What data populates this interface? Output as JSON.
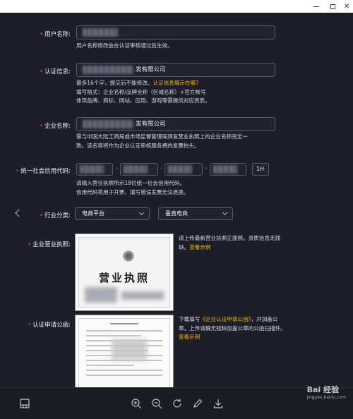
{
  "form": {
    "username": {
      "label": "用户名称:",
      "hint": "用户名称修改会在认证审核通过后生效。"
    },
    "cert_info": {
      "label": "认证信息:",
      "value_suffix": "发有限公司",
      "hint_prefix": "最多16个字，提交后不能修改。",
      "hint_link": "认证信息展示在哪？",
      "hint_line2": "填写格式：企业名称/品牌全称（区域名称）+官方帐号",
      "hint_line3": "体现品牌、商标、网站、应用、游戏等需提供对应资质。"
    },
    "company_name": {
      "label": "企业名称:",
      "value_suffix": "发有限公司",
      "hint_line1": "需与中国大陆工商局或市场监督管理局颁发营业执照上的企业名称完全一",
      "hint_line2": "致。该名称将作为企业认证审核服务费的发票抬头。"
    },
    "credit_code": {
      "label": "统一社会信用代码:",
      "separator": "-",
      "last_segment": "1H",
      "hint_line1": "请输入营业执照所示18位统一社会信用代码。",
      "hint_line2": "信用代码将用于开票，填写错误发票无法退换。"
    },
    "industry": {
      "label": "行业分类:",
      "primary": "电商平台",
      "secondary": "垂直电商"
    },
    "business_license": {
      "label": "企业营业执照:",
      "doc_title": "营业执照",
      "hint_line1": "请上传最新营业执照正面照。资质信息无残",
      "hint_line2_prefix": "缺。",
      "hint_link": "查看示例"
    },
    "application": {
      "label": "认证申请公函:",
      "hint_line1_prefix": "下载填写",
      "hint_line1_link": "《企业认证申请公函》",
      "hint_line1_suffix": "，并加盖公",
      "hint_line2": "章。上传请确无残缺加盖公章的公函扫描件。",
      "hint_link": "查看示例"
    }
  },
  "watermark": {
    "main": "Bai 经验",
    "sub": "jingyan.baidu.com"
  },
  "colors": {
    "background": "#1e1e2a",
    "required": "#e23b3b",
    "link": "#f2b600"
  },
  "icons": [
    "minimize-icon",
    "maximize-icon",
    "close-icon",
    "chevron-left-icon",
    "panel-icon",
    "zoom-in-icon",
    "zoom-out-icon",
    "rotate-icon",
    "edit-icon",
    "download-icon"
  ]
}
